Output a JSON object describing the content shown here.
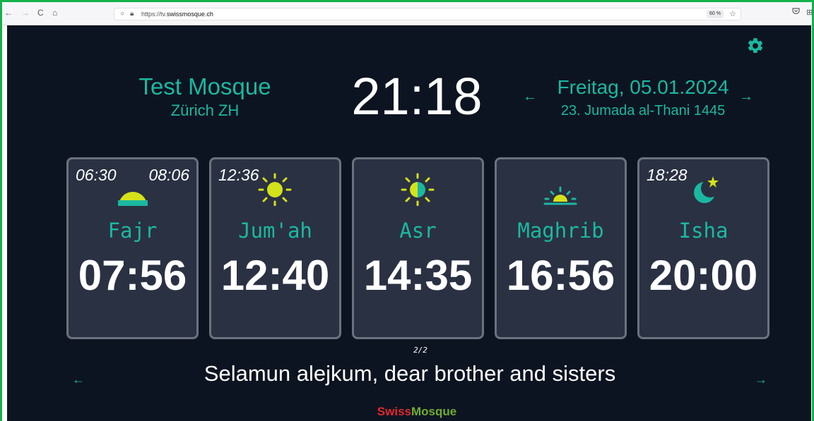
{
  "browser": {
    "back_icon": "←",
    "forward_icon": "→",
    "reload_icon": "C",
    "home_icon": "⌂",
    "url_prefix": "https://tv.",
    "url_domain": "swissmosque.ch",
    "zoom": "60 %",
    "bookmark_icon": "☆"
  },
  "header": {
    "mosque_name": "Test Mosque",
    "city": "Zürich ZH",
    "clock": "21:18",
    "gregorian_date": "Freitag, 05.01.2024",
    "hijri_date": "23. Jumada al-Thani 1445",
    "prev_arrow": "←",
    "next_arrow": "→"
  },
  "prayers": [
    {
      "name": "Fajr",
      "time": "07:56",
      "left_note": "06:30",
      "right_note": "08:06",
      "icon": "sunrise-icon"
    },
    {
      "name": "Jum'ah",
      "time": "12:40",
      "left_note": "12:36",
      "right_note": "",
      "icon": "sun-icon"
    },
    {
      "name": "Asr",
      "time": "14:35",
      "left_note": "",
      "right_note": "",
      "icon": "half-sun-icon"
    },
    {
      "name": "Maghrib",
      "time": "16:56",
      "left_note": "",
      "right_note": "",
      "icon": "sunset-icon"
    },
    {
      "name": "Isha",
      "time": "20:00",
      "left_note": "18:28",
      "right_note": "",
      "icon": "moon-star-icon"
    }
  ],
  "pager": "2/2",
  "message": {
    "text": "Selamun alejkum, dear brother and sisters",
    "prev_arrow": "←",
    "next_arrow": "→"
  },
  "logo": {
    "part1": "Swiss",
    "part2": "Mosque"
  },
  "colors": {
    "accent": "#1bb8a0",
    "background": "#0d1421",
    "card": "#2a3143",
    "sun": "#d4e21a",
    "logo_red": "#e0282e",
    "logo_green": "#6fae2f"
  }
}
